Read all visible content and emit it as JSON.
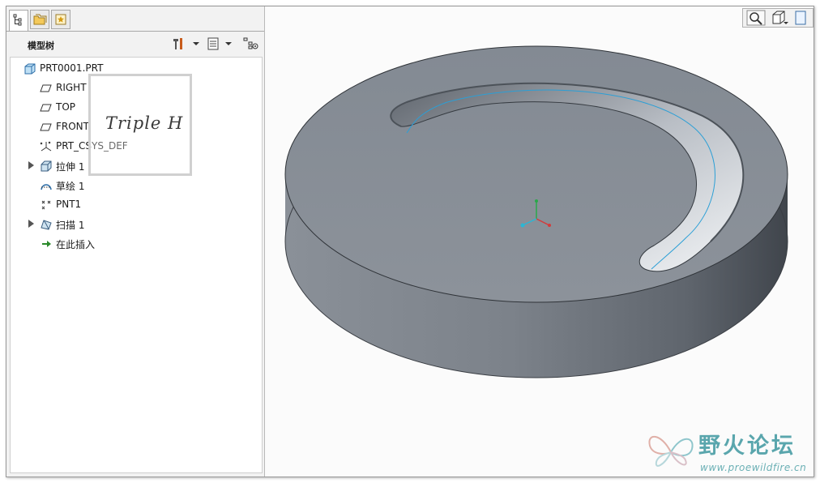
{
  "panel": {
    "title": "模型树",
    "tabs": [
      {
        "name": "model-tree-tab",
        "icon": "tree-icon",
        "active": true
      },
      {
        "name": "folder-browser-tab",
        "icon": "folders-icon",
        "active": false
      },
      {
        "name": "favorites-tab",
        "icon": "favorites-icon",
        "active": false
      }
    ],
    "header_icons": [
      "settings-tools-icon",
      "show-columns-icon",
      "filter-display-icon"
    ]
  },
  "tree": {
    "items": [
      {
        "label": "PRT0001.PRT",
        "icon": "part-icon",
        "indent": 0,
        "expandable": false
      },
      {
        "label": "RIGHT",
        "icon": "datum-plane-icon",
        "indent": 1,
        "expandable": false
      },
      {
        "label": "TOP",
        "icon": "datum-plane-icon",
        "indent": 1,
        "expandable": false
      },
      {
        "label": "FRONT",
        "icon": "datum-plane-icon",
        "indent": 1,
        "expandable": false
      },
      {
        "label": "PRT_CSYS_DEF",
        "icon": "csys-icon",
        "indent": 1,
        "expandable": false
      },
      {
        "label": "拉伸 1",
        "icon": "extrude-icon",
        "indent": 1,
        "expandable": true
      },
      {
        "label": "草绘 1",
        "icon": "sketch-icon",
        "indent": 1,
        "expandable": false
      },
      {
        "label": "PNT1",
        "icon": "datum-point-icon",
        "indent": 1,
        "expandable": false
      },
      {
        "label": "扫描 1",
        "icon": "sweep-icon",
        "indent": 1,
        "expandable": true
      },
      {
        "label": "在此插入",
        "icon": "insert-here-icon",
        "indent": 1,
        "expandable": false
      }
    ]
  },
  "watermark": {
    "text": "Triple H"
  },
  "viewport_tools": [
    "zoom-icon",
    "view-cube-icon",
    "saved-views-icon"
  ],
  "logo": {
    "name": "野火论坛",
    "url": "www.proewildfire.cn"
  },
  "colors": {
    "model_top": "#878d96",
    "model_side": "#6f757d",
    "sketch_line": "#2b9fd6",
    "logo": "#5aa6ad"
  }
}
